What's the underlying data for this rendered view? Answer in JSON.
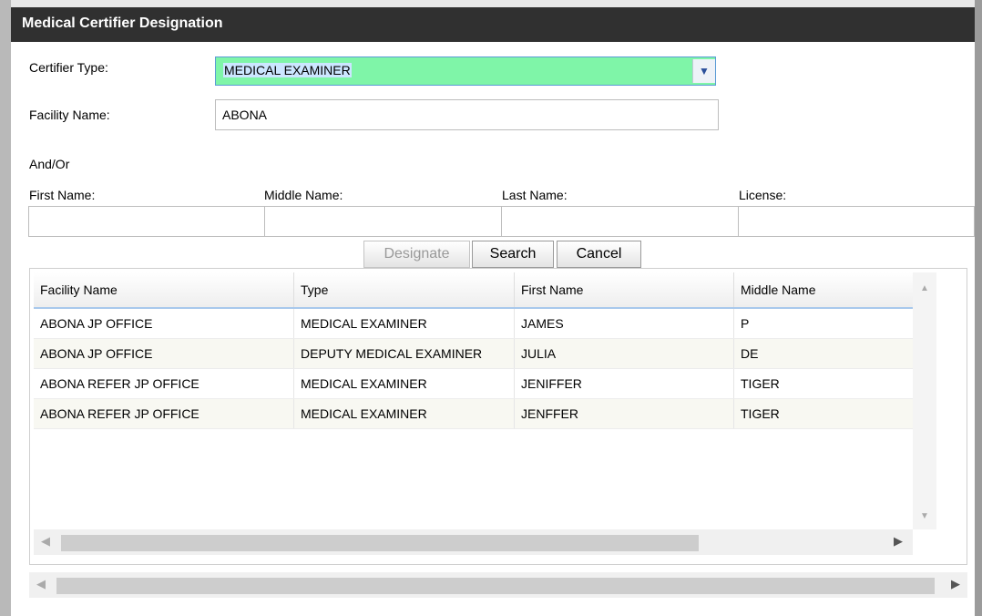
{
  "window": {
    "title": "Medical Certifier Designation"
  },
  "form": {
    "certifier_type_label": "Certifier Type:",
    "certifier_type_value": "MEDICAL EXAMINER",
    "facility_name_label": "Facility Name:",
    "facility_name_value": "ABONA",
    "and_or_label": "And/Or",
    "first_name_label": "First Name:",
    "middle_name_label": "Middle Name:",
    "last_name_label": "Last Name:",
    "license_label": "License:",
    "first_name_value": "",
    "middle_name_value": "",
    "last_name_value": "",
    "license_value": ""
  },
  "buttons": {
    "designate": "Designate",
    "search": "Search",
    "cancel": "Cancel"
  },
  "grid": {
    "columns": [
      "Facility Name",
      "Type",
      "First Name",
      "Middle Name"
    ],
    "rows": [
      [
        "ABONA JP OFFICE",
        "MEDICAL EXAMINER",
        "JAMES",
        "P"
      ],
      [
        "ABONA JP OFFICE",
        "DEPUTY MEDICAL EXAMINER",
        "JULIA",
        "DE"
      ],
      [
        "ABONA REFER JP OFFICE",
        "MEDICAL EXAMINER",
        "JENIFFER",
        "TIGER"
      ],
      [
        "ABONA REFER JP OFFICE",
        "MEDICAL EXAMINER",
        "JENFFER",
        "TIGER"
      ]
    ]
  },
  "icons": {
    "dropdown": "chevron-down-icon",
    "scroll_up": "scroll-up-icon",
    "scroll_down": "scroll-down-icon",
    "scroll_left": "scroll-left-icon",
    "scroll_right": "scroll-right-icon"
  },
  "colors": {
    "titlebar": "#303030",
    "selected_field": "#7ff5a8",
    "header_border": "#a8c8ec"
  }
}
